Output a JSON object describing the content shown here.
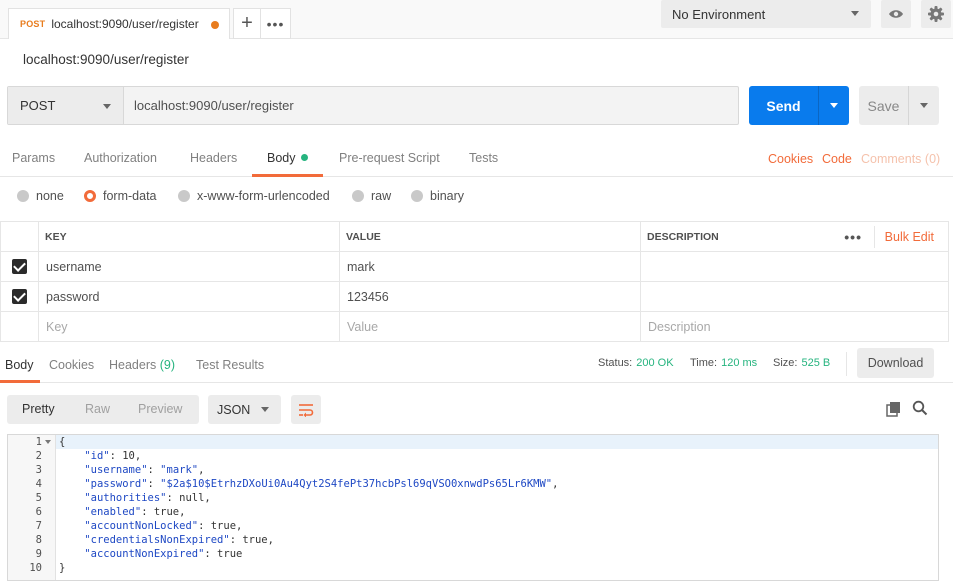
{
  "tab": {
    "method": "POST",
    "name": "localhost:9090/user/register"
  },
  "environment": {
    "selected": "No Environment"
  },
  "request": {
    "title": "localhost:9090/user/register",
    "method": "POST",
    "url": "localhost:9090/user/register",
    "send_label": "Send",
    "save_label": "Save"
  },
  "subtabs": {
    "params": "Params",
    "authorization": "Authorization",
    "headers": "Headers",
    "body": "Body",
    "prerequest": "Pre-request Script",
    "tests": "Tests",
    "cookies": "Cookies",
    "code": "Code",
    "comments": "Comments (0)"
  },
  "body_types": {
    "none": "none",
    "form_data": "form-data",
    "urlencoded": "x-www-form-urlencoded",
    "raw": "raw",
    "binary": "binary",
    "selected": "form-data"
  },
  "params_table": {
    "headers": {
      "key": "KEY",
      "value": "VALUE",
      "description": "DESCRIPTION",
      "bulk_edit": "Bulk Edit"
    },
    "rows": [
      {
        "key": "username",
        "value": "mark",
        "description": ""
      },
      {
        "key": "password",
        "value": "123456",
        "description": ""
      }
    ],
    "placeholders": {
      "key": "Key",
      "value": "Value",
      "description": "Description"
    }
  },
  "response": {
    "tabs": {
      "body": "Body",
      "cookies": "Cookies",
      "headers": "Headers",
      "headers_count": "(9)",
      "test_results": "Test Results"
    },
    "status_label": "Status:",
    "status_value": "200 OK",
    "time_label": "Time:",
    "time_value": "120 ms",
    "size_label": "Size:",
    "size_value": "525 B",
    "download_label": "Download",
    "views": {
      "pretty": "Pretty",
      "raw": "Raw",
      "preview": "Preview"
    },
    "format": "JSON",
    "code_lines": [
      "{",
      "    \"id\": 10,",
      "    \"username\": \"mark\",",
      "    \"password\": \"$2a$10$EtrhzDXoUi0Au4Qyt2S4fePt37hcbPsl69qVSO0xnwdPs65Lr6KMW\",",
      "    \"authorities\": null,",
      "    \"enabled\": true,",
      "    \"accountNonLocked\": true,",
      "    \"credentialsNonExpired\": true,",
      "    \"accountNonExpired\": true",
      "}"
    ],
    "json": {
      "id": "10",
      "username": "\"mark\"",
      "password": "\"$2a$10$EtrhzDXoUi0Au4Qyt2S4fePt37hcbPsl69qVSO0xnwdPs65Lr6KMW\"",
      "authorities": "null",
      "enabled": "true",
      "accountNonLocked": "true",
      "credentialsNonExpired": "true",
      "accountNonExpired": "true"
    }
  },
  "colors": {
    "accent": "#f26b3a",
    "send": "#097bed",
    "success": "#26b47f",
    "method_badge": "#e87c1e"
  }
}
